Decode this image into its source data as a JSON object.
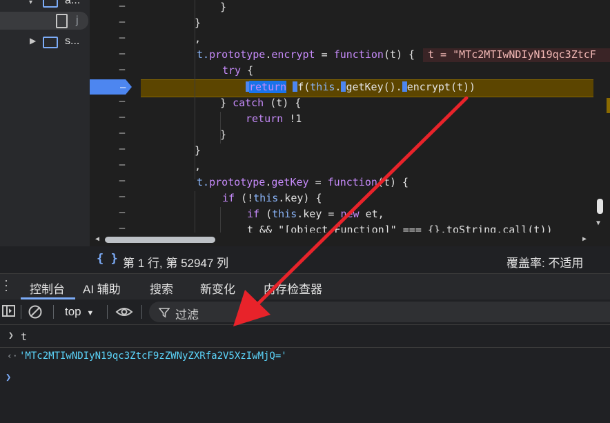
{
  "tree": {
    "row0_label": "a...",
    "file_label": "j",
    "row2_label": "s..."
  },
  "code": {
    "gutter_dash": "–",
    "l1": "}",
    "l2": "}",
    "l3": ",",
    "l4_obj": "t.",
    "l4_proto": "prototype",
    "l4_dot": ".",
    "l4_name": "encrypt",
    "l4_eq": " = ",
    "l4_func": "function",
    "l4_args": "(t) {",
    "l4_inline": "t = \"MTc2MTIwNDIyN19qc3ZtcF",
    "l5_kw": "try",
    "l5_rest": " {",
    "l6_return": "return",
    "l6_a": "f(",
    "l6_this": "this",
    "l6_b": ".",
    "l6_getkey": "getKey",
    "l6_c": "().",
    "l6_enc": "encrypt",
    "l6_d": "(t))",
    "l7_a": "} ",
    "l7_catch": "catch",
    "l7_b": " (t) {",
    "l8_return": "return",
    "l8_rest": " !1",
    "l9": "}",
    "l10": "}",
    "l11": ",",
    "l12_obj": "t.",
    "l12_proto": "prototype",
    "l12_dot": ".",
    "l12_name": "getKey",
    "l12_eq": " = ",
    "l12_func": "function",
    "l12_args": "(t) {",
    "l13_if": "if",
    "l13_a": " (!",
    "l13_this": "this",
    "l13_b": ".key) {",
    "l14_if": "if",
    "l14_a": " (",
    "l14_this": "this",
    "l14_b": ".key = ",
    "l14_new": "new",
    "l14_c": " et,",
    "l15": "t && \"[object Function]\" === {}.toString.call(t))"
  },
  "status": {
    "braces": "{ }",
    "position": "第 1 行, 第 52947 列",
    "coverage": "覆盖率: 不适用"
  },
  "tabs": [
    "控制台",
    "AI 辅助",
    "搜索",
    "新变化",
    "内存检查器"
  ],
  "toolbar": {
    "context": "top",
    "filter_label": "过滤"
  },
  "console": {
    "input_cmd": "t",
    "output_value": "'MTc2MTIwNDIyN19qc3ZtcF9zZWNyZXRfa2V5XzIwMjQ='"
  },
  "colors": {
    "accent": "#7cacf8",
    "breakpoint": "#4d86f0",
    "paused_line": "#5c4500",
    "arrow": "#e8232a"
  }
}
